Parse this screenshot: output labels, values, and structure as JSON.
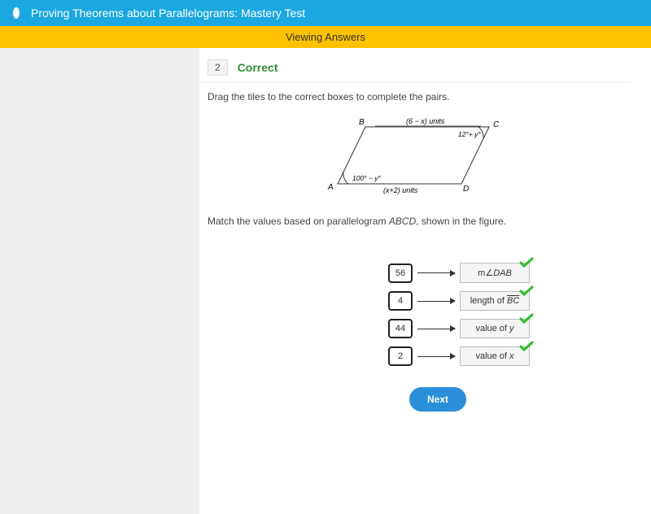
{
  "header": {
    "title": "Proving Theorems about Parallelograms: Mastery Test"
  },
  "banner": {
    "text": "Viewing Answers"
  },
  "question": {
    "number": "2",
    "status": "Correct",
    "instruction": "Drag the tiles to the correct boxes to complete the pairs.",
    "sub_instruction_prefix": "Match the values based on parallelogram ",
    "sub_instruction_shape": "ABCD",
    "sub_instruction_suffix": ", shown in the figure."
  },
  "figure": {
    "label_B": "B",
    "label_C": "C",
    "label_A": "A",
    "label_D": "D",
    "top_side": "(6 − x) units",
    "bottom_side": "(x+2) units",
    "angle_A": "100° − y°",
    "angle_C": "12°+ y°"
  },
  "pairs": [
    {
      "left": "56",
      "right_html": "m∠<i>DAB</i>"
    },
    {
      "left": "4",
      "right_html": "length of <span class='over'><i>BC</i></span>"
    },
    {
      "left": "44",
      "right_html": "value of <i>y</i>"
    },
    {
      "left": "2",
      "right_html": "value of <i>x</i>"
    }
  ],
  "buttons": {
    "next": "Next"
  }
}
